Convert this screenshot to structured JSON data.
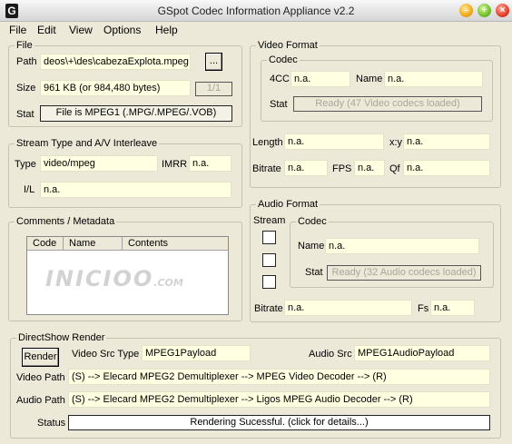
{
  "window": {
    "title": "GSpot Codec Information Appliance  v2.2",
    "icon_glyph": "G"
  },
  "menu": [
    "File",
    "Edit",
    "View",
    "Options",
    "Help"
  ],
  "file": {
    "group_label": "File",
    "path_label": "Path",
    "path_value": "deos\\+\\des\\cabezaExplota.mpeg",
    "browse_label": "...",
    "size_label": "Size",
    "size_value": "961 KB (or 984,480 bytes)",
    "size_index": "1/1",
    "stat_label": "Stat",
    "stat_value": "File is MPEG1 (.MPG/.MPEG/.VOB)"
  },
  "stream": {
    "group_label": "Stream Type and A/V Interleave",
    "type_label": "Type",
    "type_value": "video/mpeg",
    "imrr_label": "IMRR",
    "imrr_value": "n.a.",
    "il_label": "I/L",
    "il_value": "n.a."
  },
  "comments": {
    "group_label": "Comments / Metadata",
    "columns": [
      "Code",
      "Name",
      "Contents"
    ],
    "watermark": "INICIOO",
    "watermark_sub": ".COM"
  },
  "video": {
    "group_label": "Video Format",
    "codec_label": "Codec",
    "fourcc_label": "4CC",
    "fourcc_value": "n.a.",
    "name_label": "Name",
    "name_value": "n.a.",
    "stat_label": "Stat",
    "stat_value": "Ready (47 Video codecs loaded)",
    "length_label": "Length",
    "length_value": "n.a.",
    "xy_label": "x:y",
    "xy_value": "n.a.",
    "bitrate_label": "Bitrate",
    "bitrate_value": "n.a.",
    "fps_label": "FPS",
    "fps_value": "n.a.",
    "qf_label": "Qf",
    "qf_value": "n.a."
  },
  "audio": {
    "group_label": "Audio Format",
    "stream_label": "Stream",
    "codec_label": "Codec",
    "name_label": "Name",
    "name_value": "n.a.",
    "stat_label": "Stat",
    "stat_value": "Ready (32 Audio codecs loaded)",
    "bitrate_label": "Bitrate",
    "bitrate_value": "n.a.",
    "fs_label": "Fs",
    "fs_value": "n.a."
  },
  "directshow": {
    "group_label": "DirectShow Render",
    "render_label": "Render",
    "video_src_label": "Video Src Type",
    "video_src_value": "MPEG1Payload",
    "audio_src_label": "Audio Src",
    "audio_src_value": "MPEG1AudioPayload",
    "video_path_label": "Video Path",
    "video_path_value": "(S) --> Elecard MPEG2 Demultiplexer --> MPEG Video Decoder --> (R)",
    "audio_path_label": "Audio Path",
    "audio_path_value": "(S) --> Elecard MPEG2 Demultiplexer --> Ligos MPEG Audio Decoder --> (R)",
    "status_label": "Status",
    "status_value": "Rendering Sucessful.  (click for details...)"
  }
}
